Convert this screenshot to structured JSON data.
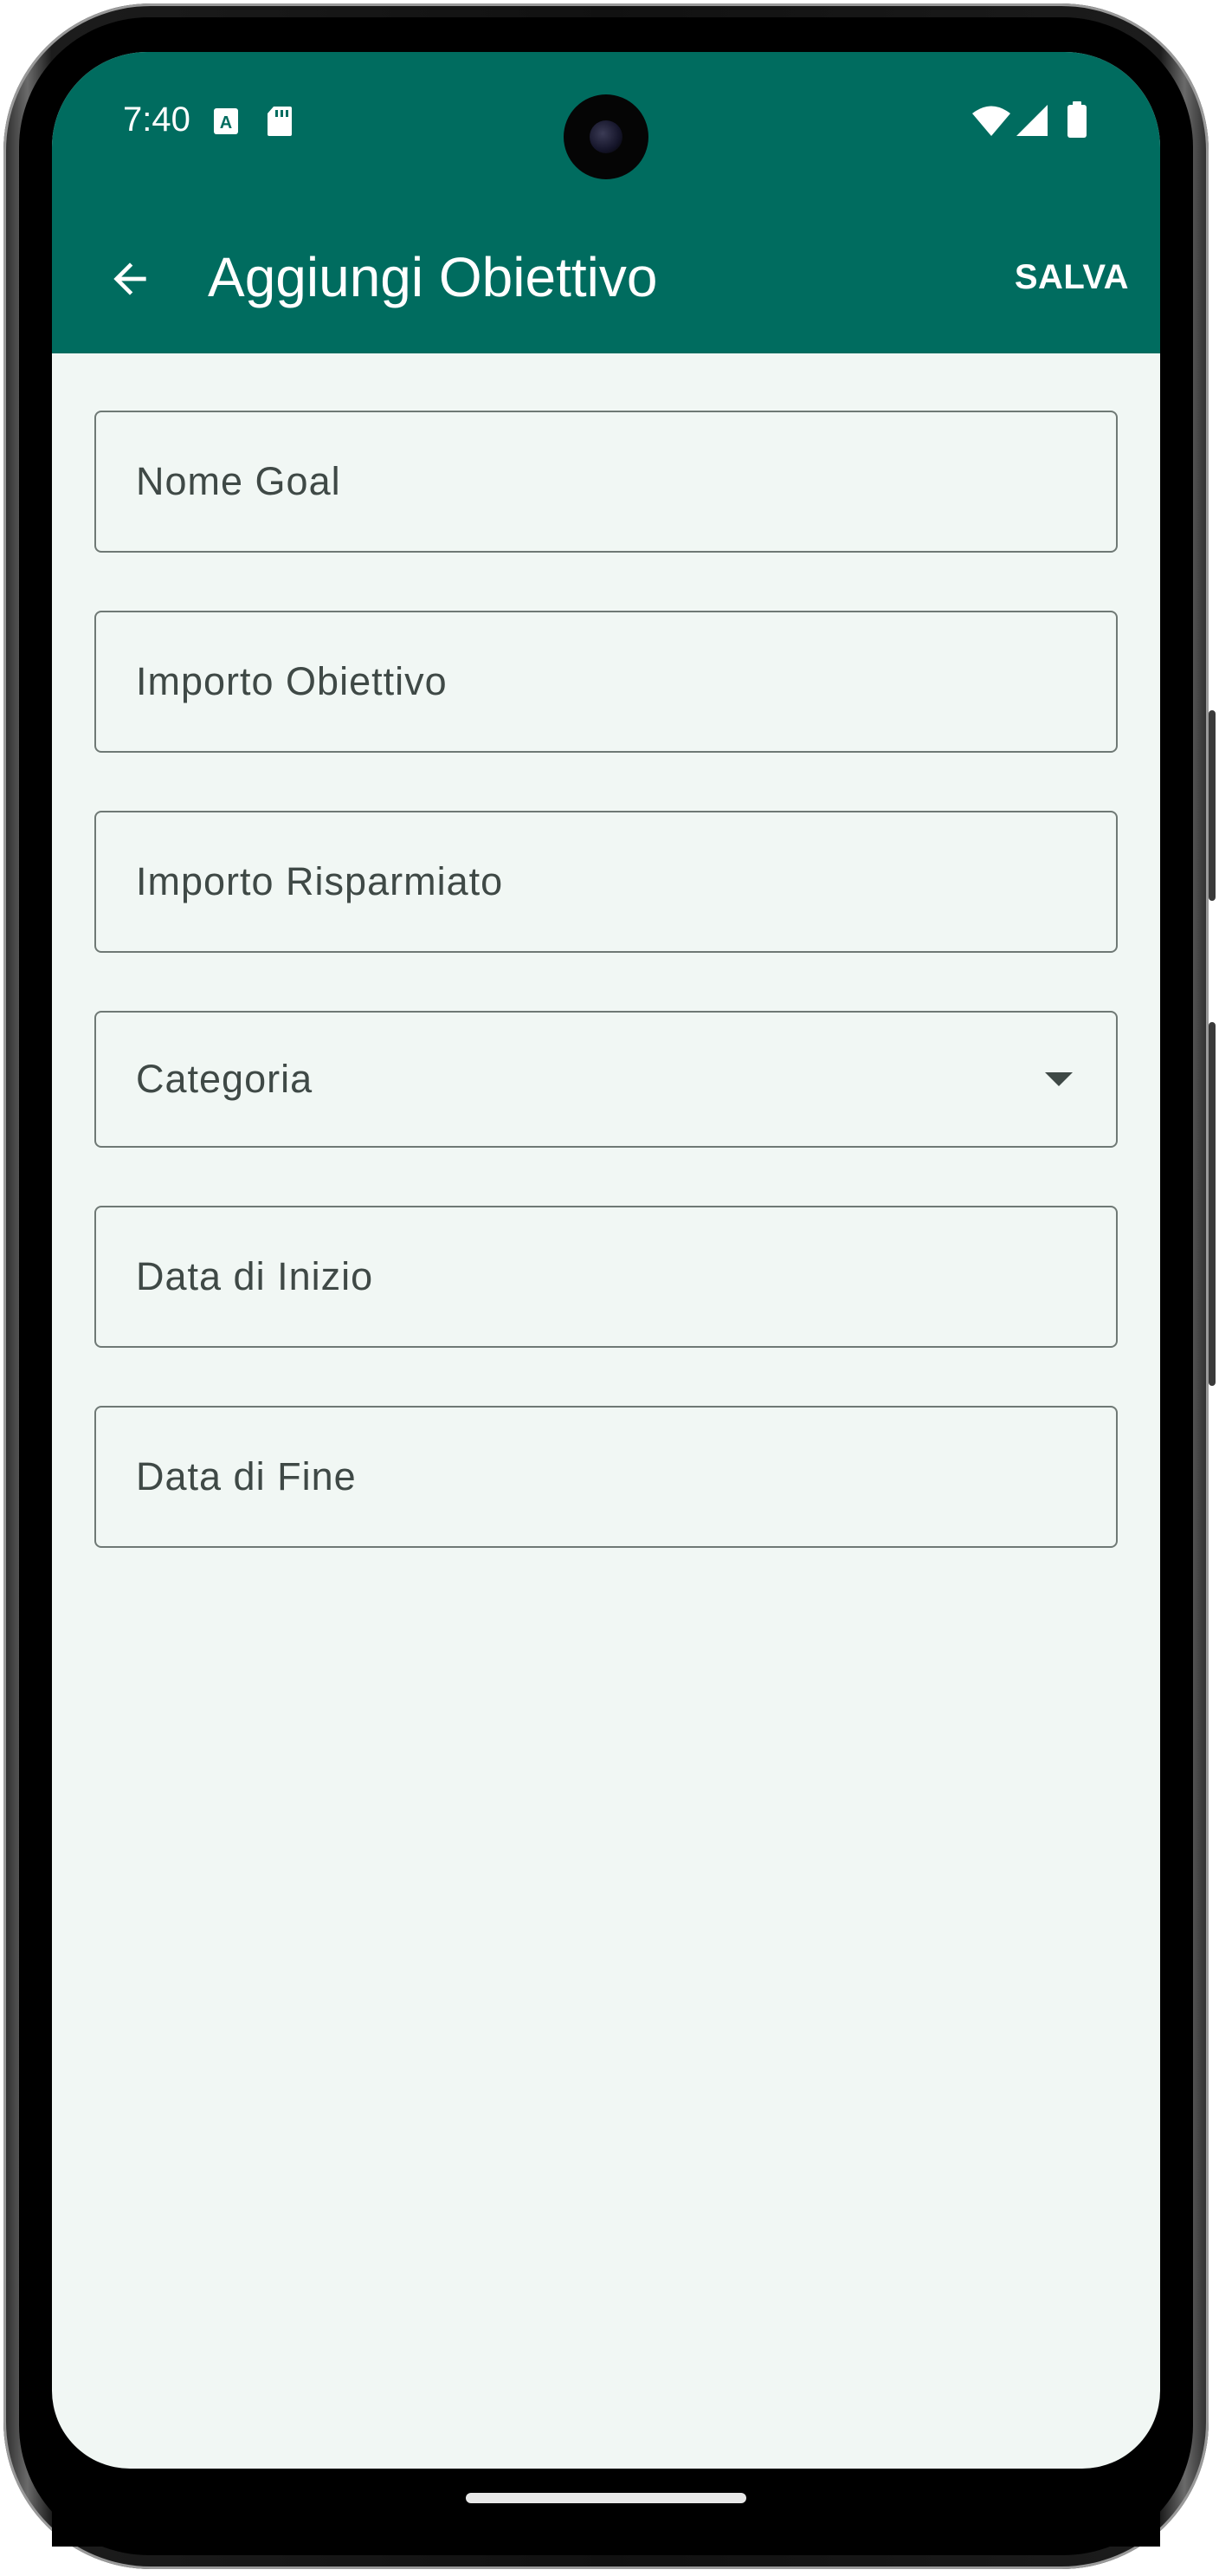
{
  "status_bar": {
    "time": "7:40"
  },
  "app_bar": {
    "title": "Aggiungi Obiettivo",
    "save_label": "SALVA",
    "back_icon": "arrow-back-icon",
    "background_color": "#006c5f"
  },
  "form": {
    "fields": [
      {
        "label": "Nome Goal",
        "type": "text"
      },
      {
        "label": "Importo Obiettivo",
        "type": "number"
      },
      {
        "label": "Importo Risparmiato",
        "type": "number"
      },
      {
        "label": "Categoria",
        "type": "dropdown"
      },
      {
        "label": "Data di Inizio",
        "type": "date"
      },
      {
        "label": "Data di Fine",
        "type": "date"
      }
    ]
  },
  "colors": {
    "accent": "#006c5f",
    "background": "#f1f7f4",
    "outline": "#6f7975",
    "label": "#3f4946"
  }
}
